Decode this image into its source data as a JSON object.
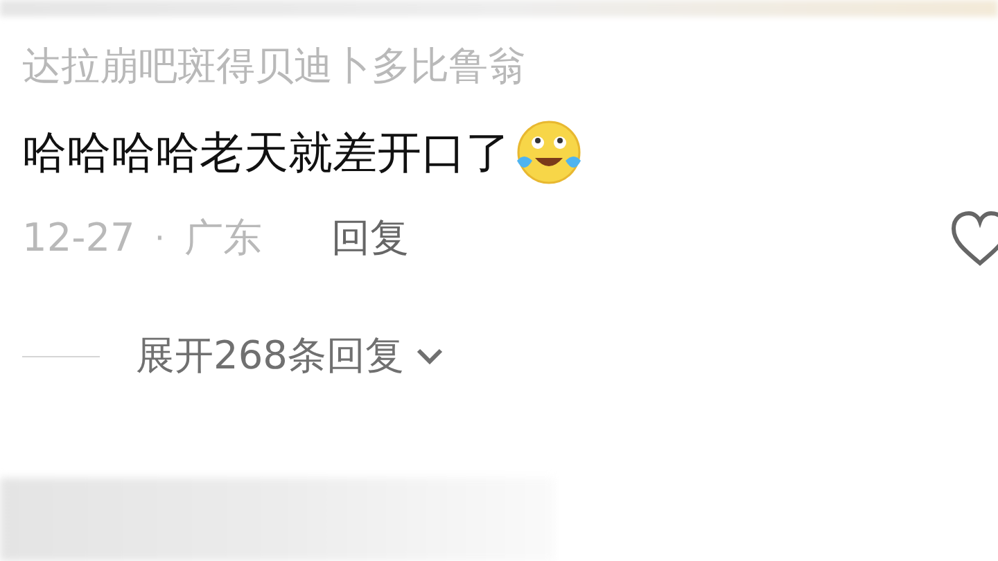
{
  "comment": {
    "username": "达拉崩吧斑得贝迪卜多比鲁翁",
    "text": "哈哈哈哈老天就差开口了",
    "date": "12-27",
    "separator": "·",
    "location": "广东",
    "reply_button": "回复",
    "liked": false
  },
  "expand_replies": {
    "label": "展开268条回复",
    "expanded": false
  }
}
